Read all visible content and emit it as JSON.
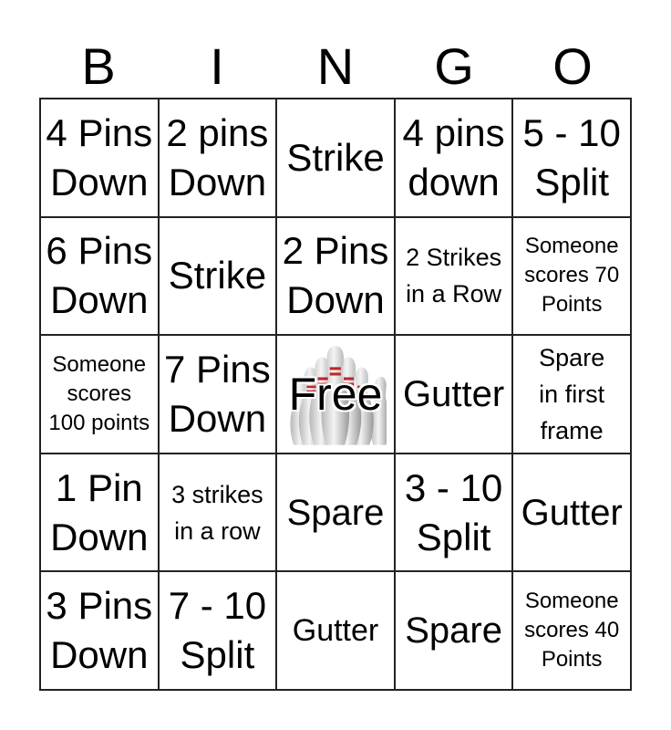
{
  "header": {
    "letters": [
      "B",
      "I",
      "N",
      "G",
      "O"
    ]
  },
  "rows": [
    [
      "4 Pins\nDown",
      "2 pins\nDown",
      "Strike",
      "4 pins\ndown",
      "5 - 10\nSplit"
    ],
    [
      "6 Pins\nDown",
      "Strike",
      "2 Pins\nDown",
      "2 Strikes\nin a Row",
      "Someone\nscores 70\nPoints"
    ],
    [
      "Someone\nscores\n100 points",
      "7 Pins\nDown",
      "Free",
      "Gutter",
      "Spare\nin first\nframe"
    ],
    [
      "1 Pin\nDown",
      "3 strikes\nin a row",
      "Spare",
      "3 - 10\nSplit",
      "Gutter"
    ],
    [
      "3 Pins\nDown",
      "7 - 10\nSplit",
      "Gutter",
      "Spare",
      "Someone\nscores 40\nPoints"
    ]
  ],
  "free_space": {
    "label": "Free",
    "image": "bowling-pins"
  }
}
